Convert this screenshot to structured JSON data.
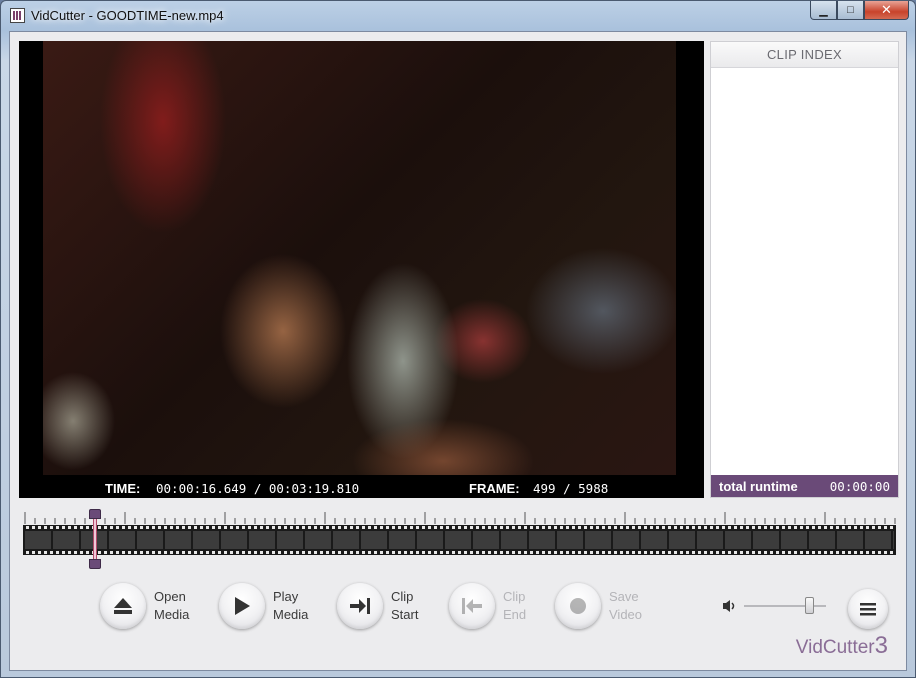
{
  "window": {
    "title": "VidCutter - GOODTIME-new.mp4",
    "controls": {
      "minimize": "▁",
      "maximize": "□",
      "close": "✕"
    }
  },
  "video": {
    "time_label": "TIME:",
    "time_value": "00:00:16.649 / 00:03:19.810",
    "frame_label": "FRAME:",
    "frame_value": "499 / 5988"
  },
  "clip_index": {
    "header": "CLIP INDEX",
    "runtime_label": "total runtime",
    "runtime_value": "00:00:00"
  },
  "timeline": {
    "position_fraction": 0.083
  },
  "toolbar": {
    "open_line1": "Open",
    "open_line2": "Media",
    "play_line1": "Play",
    "play_line2": "Media",
    "clipstart_line1": "Clip",
    "clipstart_line2": "Start",
    "clipend_line1": "Clip",
    "clipend_line2": "End",
    "save_line1": "Save",
    "save_line2": "Video",
    "icons": [
      "eject-icon",
      "play-icon",
      "clip-start-icon",
      "clip-end-icon",
      "record-icon",
      "volume-icon",
      "menu-icon"
    ]
  },
  "volume": {
    "level_fraction": 0.8
  },
  "brand": {
    "name": "VidCutter",
    "version": "3"
  },
  "colors": {
    "accent": "#6a4a78",
    "brand": "#8a6d96"
  }
}
